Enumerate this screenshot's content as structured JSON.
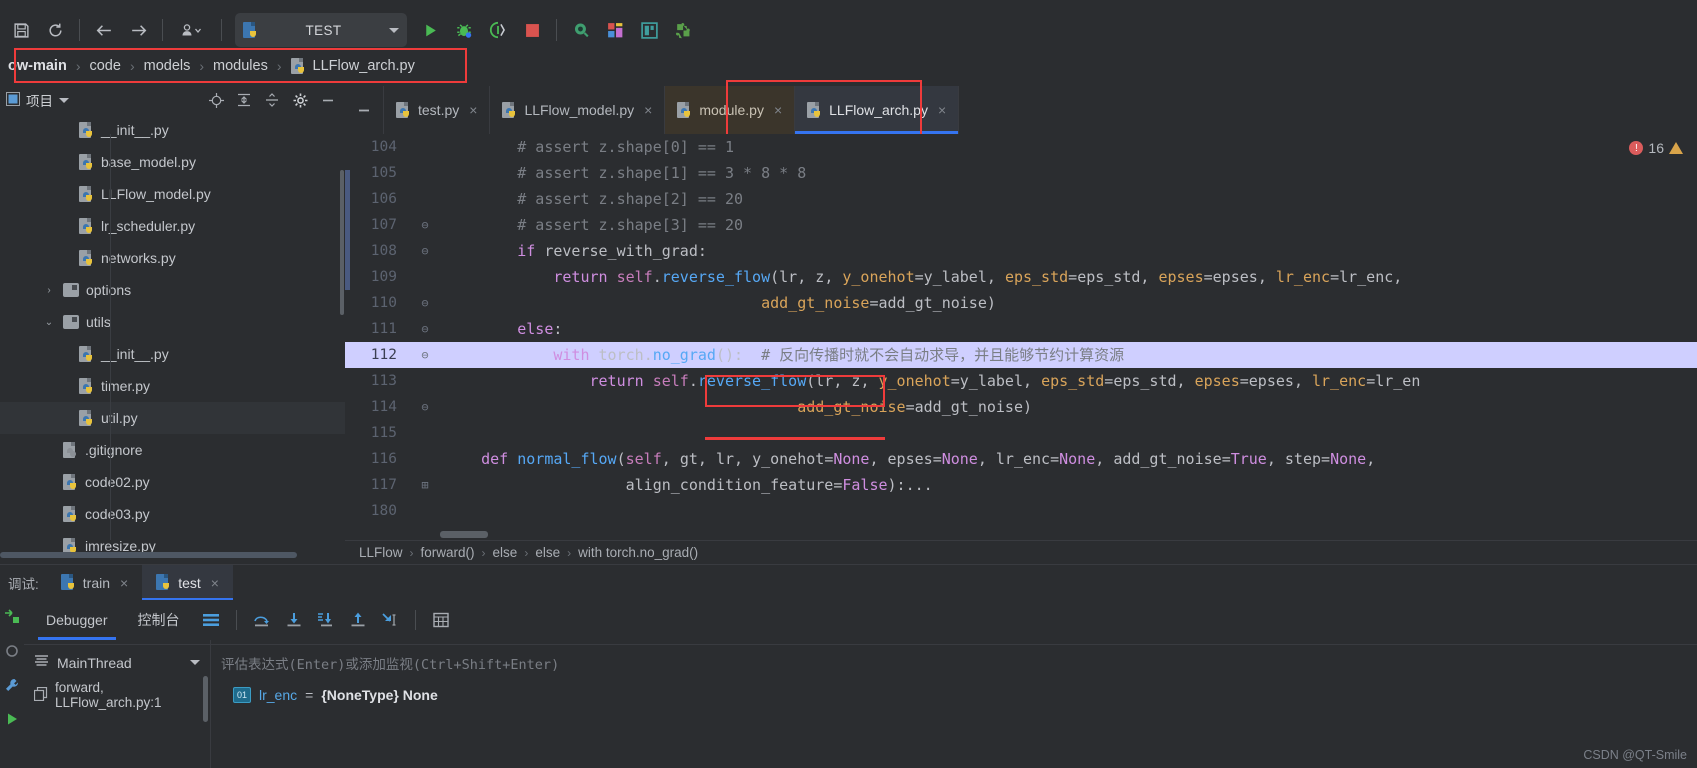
{
  "toolbar": {
    "save_label": "ὋE",
    "icons": [
      "save-icon",
      "sync-icon",
      "back-arrow-icon",
      "forward-arrow-icon",
      "vcs-update-icon"
    ],
    "run_config_name": "TEST",
    "run_label": "▶",
    "debug_label": "🐞",
    "coverage_label": "◑",
    "stop_label": "■",
    "search_label": "●",
    "layout_label": "▣",
    "db_label": "▥",
    "plugin_label": "✷"
  },
  "breadcrumb": {
    "items": [
      {
        "label": "ow-main",
        "icon": "folder-icon"
      },
      {
        "label": "code",
        "icon": "folder-icon"
      },
      {
        "label": "models",
        "icon": "folder-icon"
      },
      {
        "label": "modules",
        "icon": "folder-icon"
      },
      {
        "label": "LLFlow_arch.py",
        "icon": "python-file-icon"
      }
    ],
    "separator": "›"
  },
  "project_panel": {
    "title": "项目",
    "dropdown_caret": "▼",
    "actions": [
      "locate-icon",
      "expand-all-icon",
      "collapse-all-icon",
      "settings-gear-icon",
      "minimize-icon"
    ],
    "tree": [
      {
        "label": "__init__.py",
        "indent": 3,
        "icon": "python-file-icon",
        "arrow": "",
        "selected": false
      },
      {
        "label": "base_model.py",
        "indent": 3,
        "icon": "python-file-icon",
        "arrow": "",
        "selected": false
      },
      {
        "label": "LLFlow_model.py",
        "indent": 3,
        "icon": "python-file-icon",
        "arrow": "",
        "selected": false
      },
      {
        "label": "lr_scheduler.py",
        "indent": 3,
        "icon": "python-file-icon",
        "arrow": "",
        "selected": false
      },
      {
        "label": "networks.py",
        "indent": 3,
        "icon": "python-file-icon",
        "arrow": "",
        "selected": false
      },
      {
        "label": "options",
        "indent": 2,
        "icon": "folder-icon",
        "arrow": "›",
        "selected": false
      },
      {
        "label": "utils",
        "indent": 2,
        "icon": "folder-icon",
        "arrow": "⌄",
        "selected": false
      },
      {
        "label": "__init__.py",
        "indent": 3,
        "icon": "python-file-icon",
        "arrow": "",
        "selected": false
      },
      {
        "label": "timer.py",
        "indent": 3,
        "icon": "python-file-icon",
        "arrow": "",
        "selected": false
      },
      {
        "label": "util.py",
        "indent": 3,
        "icon": "python-file-icon",
        "arrow": "",
        "selected": true
      },
      {
        "label": ".gitignore",
        "indent": 2,
        "icon": "gitignore-file-icon",
        "arrow": "",
        "selected": false
      },
      {
        "label": "code02.py",
        "indent": 2,
        "icon": "python-file-icon",
        "arrow": "",
        "selected": false
      },
      {
        "label": "code03.py",
        "indent": 2,
        "icon": "python-file-icon",
        "arrow": "",
        "selected": false
      },
      {
        "label": "imresize.py",
        "indent": 2,
        "icon": "python-file-icon",
        "arrow": "",
        "selected": false
      }
    ]
  },
  "editor_tabs": [
    {
      "label": "test.py",
      "state": "normal",
      "close": "×"
    },
    {
      "label": "LLFlow_model.py",
      "state": "normal",
      "close": "×"
    },
    {
      "label": "module.py",
      "state": "modified",
      "close": "×"
    },
    {
      "label": "LLFlow_arch.py",
      "state": "active",
      "close": "×"
    }
  ],
  "inspection": {
    "error_count": "16",
    "error_icon": "error-circle-icon",
    "warning_icon": "warning-triangle-icon"
  },
  "code": {
    "lines": [
      {
        "num": "104",
        "fold": "",
        "current": false,
        "tokens": [
          {
            "t": "        # assert z.shape[0] == 1",
            "c": "cmt"
          }
        ]
      },
      {
        "num": "105",
        "fold": "",
        "current": false,
        "tokens": [
          {
            "t": "        # assert z.shape[1] == 3 * 8 * 8",
            "c": "cmt"
          }
        ]
      },
      {
        "num": "106",
        "fold": "",
        "current": false,
        "tokens": [
          {
            "t": "        # assert z.shape[2] == 20",
            "c": "cmt"
          }
        ]
      },
      {
        "num": "107",
        "fold": "⊖",
        "current": false,
        "tokens": [
          {
            "t": "        # assert z.shape[3] == 20",
            "c": "cmt"
          }
        ]
      },
      {
        "num": "108",
        "fold": "⊖",
        "current": false,
        "tokens": [
          {
            "t": "        ",
            "c": "plain"
          },
          {
            "t": "if",
            "c": "kw"
          },
          {
            "t": " reverse_with_grad",
            "c": "plain"
          },
          {
            "t": ":",
            "c": "op"
          }
        ]
      },
      {
        "num": "109",
        "fold": "",
        "current": false,
        "tokens": [
          {
            "t": "            ",
            "c": "plain"
          },
          {
            "t": "return",
            "c": "kw"
          },
          {
            "t": " ",
            "c": "plain"
          },
          {
            "t": "self",
            "c": "self"
          },
          {
            "t": ".",
            "c": "op"
          },
          {
            "t": "reverse_flow",
            "c": "fn"
          },
          {
            "t": "(",
            "c": "op"
          },
          {
            "t": "lr",
            "c": "plain"
          },
          {
            "t": ", ",
            "c": "op"
          },
          {
            "t": "z",
            "c": "plain"
          },
          {
            "t": ", ",
            "c": "op"
          },
          {
            "t": "y_onehot",
            "c": "param"
          },
          {
            "t": "=",
            "c": "op"
          },
          {
            "t": "y_label",
            "c": "plain"
          },
          {
            "t": ", ",
            "c": "op"
          },
          {
            "t": "eps_std",
            "c": "param"
          },
          {
            "t": "=",
            "c": "op"
          },
          {
            "t": "eps_std",
            "c": "plain"
          },
          {
            "t": ", ",
            "c": "op"
          },
          {
            "t": "epses",
            "c": "param"
          },
          {
            "t": "=",
            "c": "op"
          },
          {
            "t": "epses",
            "c": "plain"
          },
          {
            "t": ", ",
            "c": "op"
          },
          {
            "t": "lr_enc",
            "c": "param"
          },
          {
            "t": "=",
            "c": "op"
          },
          {
            "t": "lr_enc",
            "c": "plain"
          },
          {
            "t": ",",
            "c": "op"
          }
        ]
      },
      {
        "num": "110",
        "fold": "⊖",
        "current": false,
        "tokens": [
          {
            "t": "                                   ",
            "c": "plain"
          },
          {
            "t": "add_gt_noise",
            "c": "param"
          },
          {
            "t": "=",
            "c": "op"
          },
          {
            "t": "add_gt_noise",
            "c": "plain"
          },
          {
            "t": ")",
            "c": "op"
          }
        ]
      },
      {
        "num": "111",
        "fold": "⊖",
        "current": false,
        "tokens": [
          {
            "t": "        ",
            "c": "plain"
          },
          {
            "t": "else",
            "c": "kw"
          },
          {
            "t": ":",
            "c": "op"
          }
        ]
      },
      {
        "num": "112",
        "fold": "⊖",
        "current": true,
        "tokens": [
          {
            "t": "            ",
            "c": "plain"
          },
          {
            "t": "with",
            "c": "kw"
          },
          {
            "t": " torch",
            "c": "plain"
          },
          {
            "t": ".",
            "c": "op"
          },
          {
            "t": "no_grad",
            "c": "fn"
          },
          {
            "t": "():  ",
            "c": "op"
          },
          {
            "t": "# 反向传播时就不会自动求导，并且能够节约计算资源",
            "c": "cmt"
          }
        ]
      },
      {
        "num": "113",
        "fold": "",
        "current": false,
        "tokens": [
          {
            "t": "                ",
            "c": "plain"
          },
          {
            "t": "return",
            "c": "kw"
          },
          {
            "t": " ",
            "c": "plain"
          },
          {
            "t": "self",
            "c": "self"
          },
          {
            "t": ".",
            "c": "op"
          },
          {
            "t": "reverse_flow",
            "c": "fn"
          },
          {
            "t": "(",
            "c": "op"
          },
          {
            "t": "lr",
            "c": "plain"
          },
          {
            "t": ", ",
            "c": "op"
          },
          {
            "t": "z",
            "c": "plain"
          },
          {
            "t": ", ",
            "c": "op"
          },
          {
            "t": "y_onehot",
            "c": "param"
          },
          {
            "t": "=",
            "c": "op"
          },
          {
            "t": "y_label",
            "c": "plain"
          },
          {
            "t": ", ",
            "c": "op"
          },
          {
            "t": "eps_std",
            "c": "param"
          },
          {
            "t": "=",
            "c": "op"
          },
          {
            "t": "eps_std",
            "c": "plain"
          },
          {
            "t": ", ",
            "c": "op"
          },
          {
            "t": "epses",
            "c": "param"
          },
          {
            "t": "=",
            "c": "op"
          },
          {
            "t": "epses",
            "c": "plain"
          },
          {
            "t": ", ",
            "c": "op"
          },
          {
            "t": "lr_enc",
            "c": "param"
          },
          {
            "t": "=",
            "c": "op"
          },
          {
            "t": "lr_en",
            "c": "plain"
          }
        ]
      },
      {
        "num": "114",
        "fold": "⊖",
        "current": false,
        "tokens": [
          {
            "t": "                                       ",
            "c": "plain"
          },
          {
            "t": "add_gt_noise",
            "c": "param"
          },
          {
            "t": "=",
            "c": "op"
          },
          {
            "t": "add_gt_noise",
            "c": "plain"
          },
          {
            "t": ")",
            "c": "op"
          }
        ]
      },
      {
        "num": "115",
        "fold": "",
        "current": false,
        "tokens": [
          {
            "t": "",
            "c": "plain"
          }
        ]
      },
      {
        "num": "116",
        "fold": "",
        "current": false,
        "tokens": [
          {
            "t": "    ",
            "c": "plain"
          },
          {
            "t": "def",
            "c": "kw"
          },
          {
            "t": " ",
            "c": "plain"
          },
          {
            "t": "normal_flow",
            "c": "fn"
          },
          {
            "t": "(",
            "c": "op"
          },
          {
            "t": "self",
            "c": "self"
          },
          {
            "t": ", ",
            "c": "op"
          },
          {
            "t": "gt",
            "c": "plain"
          },
          {
            "t": ", ",
            "c": "op"
          },
          {
            "t": "lr",
            "c": "plain"
          },
          {
            "t": ", ",
            "c": "op"
          },
          {
            "t": "y_onehot",
            "c": "plain"
          },
          {
            "t": "=",
            "c": "op"
          },
          {
            "t": "None",
            "c": "kw"
          },
          {
            "t": ", ",
            "c": "op"
          },
          {
            "t": "epses",
            "c": "plain"
          },
          {
            "t": "=",
            "c": "op"
          },
          {
            "t": "None",
            "c": "kw"
          },
          {
            "t": ", ",
            "c": "op"
          },
          {
            "t": "lr_enc",
            "c": "plain"
          },
          {
            "t": "=",
            "c": "op"
          },
          {
            "t": "None",
            "c": "kw"
          },
          {
            "t": ", ",
            "c": "op"
          },
          {
            "t": "add_gt_noise",
            "c": "plain"
          },
          {
            "t": "=",
            "c": "op"
          },
          {
            "t": "True",
            "c": "kw"
          },
          {
            "t": ", ",
            "c": "op"
          },
          {
            "t": "step",
            "c": "plain"
          },
          {
            "t": "=",
            "c": "op"
          },
          {
            "t": "None",
            "c": "kw"
          },
          {
            "t": ",",
            "c": "op"
          }
        ]
      },
      {
        "num": "117",
        "fold": "⊞",
        "current": false,
        "tokens": [
          {
            "t": "                    ",
            "c": "plain"
          },
          {
            "t": "align_condition_feature",
            "c": "plain"
          },
          {
            "t": "=",
            "c": "op"
          },
          {
            "t": "False",
            "c": "kw"
          },
          {
            "t": "):",
            "c": "op"
          },
          {
            "t": "...",
            "c": "plain"
          }
        ]
      },
      {
        "num": "180",
        "fold": "",
        "current": false,
        "tokens": [
          {
            "t": "",
            "c": "plain"
          }
        ]
      }
    ]
  },
  "editor_breadcrumb": {
    "items": [
      "LLFlow",
      "forward()",
      "else",
      "else",
      "with torch.no_grad()"
    ],
    "separator": "›"
  },
  "run_tabs": {
    "label": "调试:",
    "tabs": [
      {
        "label": "train",
        "active": false,
        "close": "×"
      },
      {
        "label": "test",
        "active": true,
        "close": "×"
      }
    ]
  },
  "debugger": {
    "tabs": [
      {
        "label": "Debugger",
        "active": true
      },
      {
        "label": "控制台",
        "active": false
      }
    ],
    "toolbar_icons": [
      "layout-settings-icon",
      "step-over-icon",
      "step-into-icon",
      "force-step-into-icon",
      "step-out-icon",
      "run-to-cursor-icon",
      "evaluate-expression-icon"
    ],
    "side_icons": [
      "resume-program-icon",
      "mute-breakpoints-icon",
      "settings-wrench-icon",
      "play-icon"
    ],
    "thread": {
      "icon": "thread-icon",
      "name": "MainThread",
      "caret": "▼"
    },
    "frame": {
      "icon": "frame-icon",
      "label": "forward, LLFlow_arch.py:1"
    },
    "evaluate_placeholder": "评估表达式(Enter)或添加监视(Ctrl+Shift+Enter)",
    "variables": [
      {
        "badge": "01",
        "name": "lr_enc",
        "eq": " = ",
        "type": "{NoneType} None"
      }
    ]
  },
  "watermark": "CSDN @QT-Smile",
  "colors": {
    "accent_blue": "#3574f0",
    "highlight_line": "#cfcfff",
    "red_annotation": "#ef3b3b",
    "bg": "#2b2d30"
  }
}
